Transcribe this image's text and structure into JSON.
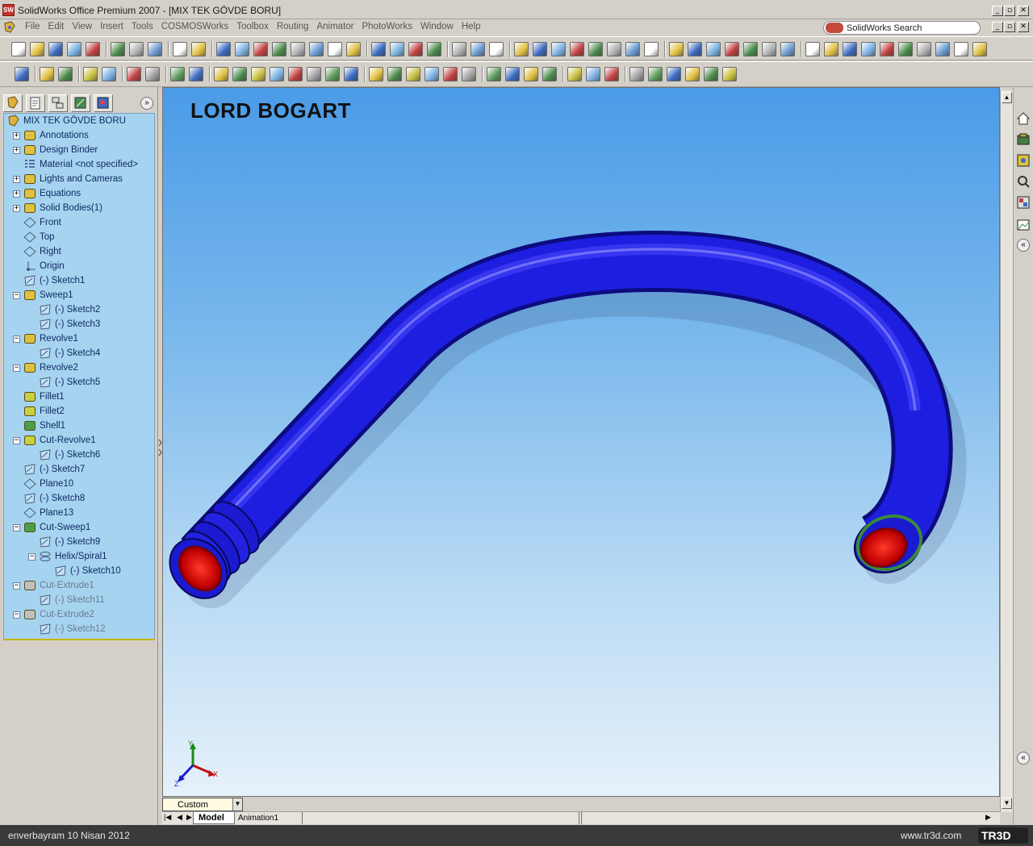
{
  "window": {
    "app_icon_text": "SW",
    "title": "SolidWorks Office Premium 2007 - [MIX TEK GÖVDE BORU]",
    "btn_min": "_",
    "btn_restore": "▫",
    "btn_close": "✕"
  },
  "menubar": {
    "items": [
      "File",
      "Edit",
      "View",
      "Insert",
      "Tools",
      "COSMOSWorks",
      "Toolbox",
      "Routing",
      "Animator",
      "PhotoWorks",
      "Window",
      "Help"
    ],
    "search_label": "SolidWorks Search"
  },
  "tree": {
    "root": "MIX TEK GÖVDE BORU",
    "items": [
      {
        "label": "Annotations",
        "expander": "+",
        "icon": "annotations-icon"
      },
      {
        "label": "Design Binder",
        "expander": "+",
        "icon": "design-binder-icon"
      },
      {
        "label": "Material <not specified>",
        "expander": "",
        "icon": "material-icon"
      },
      {
        "label": "Lights and Cameras",
        "expander": "+",
        "icon": "lights-icon"
      },
      {
        "label": "Equations",
        "expander": "+",
        "icon": "equations-icon"
      },
      {
        "label": "Solid Bodies(1)",
        "expander": "+",
        "icon": "solid-bodies-icon"
      },
      {
        "label": "Front",
        "expander": "",
        "icon": "plane-icon"
      },
      {
        "label": "Top",
        "expander": "",
        "icon": "plane-icon"
      },
      {
        "label": "Right",
        "expander": "",
        "icon": "plane-icon"
      },
      {
        "label": "Origin",
        "expander": "",
        "icon": "origin-icon"
      },
      {
        "label": "(-) Sketch1",
        "expander": "",
        "icon": "sketch-icon"
      },
      {
        "label": "Sweep1",
        "expander": "−",
        "icon": "sweep-icon"
      },
      {
        "label": "(-) Sketch2",
        "expander": "",
        "icon": "sketch-icon",
        "indent": 1
      },
      {
        "label": "(-) Sketch3",
        "expander": "",
        "icon": "sketch-icon",
        "indent": 1
      },
      {
        "label": "Revolve1",
        "expander": "−",
        "icon": "revolve-icon"
      },
      {
        "label": "(-) Sketch4",
        "expander": "",
        "icon": "sketch-icon",
        "indent": 1
      },
      {
        "label": "Revolve2",
        "expander": "−",
        "icon": "revolve-icon"
      },
      {
        "label": "(-) Sketch5",
        "expander": "",
        "icon": "sketch-icon",
        "indent": 1
      },
      {
        "label": "Fillet1",
        "expander": "",
        "icon": "fillet-icon"
      },
      {
        "label": "Fillet2",
        "expander": "",
        "icon": "fillet-icon"
      },
      {
        "label": "Shell1",
        "expander": "",
        "icon": "shell-icon"
      },
      {
        "label": "Cut-Revolve1",
        "expander": "−",
        "icon": "cut-revolve-icon"
      },
      {
        "label": "(-) Sketch6",
        "expander": "",
        "icon": "sketch-icon",
        "indent": 1
      },
      {
        "label": "(-) Sketch7",
        "expander": "",
        "icon": "sketch-icon"
      },
      {
        "label": "Plane10",
        "expander": "",
        "icon": "plane-icon"
      },
      {
        "label": "(-) Sketch8",
        "expander": "",
        "icon": "sketch-icon"
      },
      {
        "label": "Plane13",
        "expander": "",
        "icon": "plane-icon"
      },
      {
        "label": "Cut-Sweep1",
        "expander": "−",
        "icon": "cut-sweep-icon"
      },
      {
        "label": "(-) Sketch9",
        "expander": "",
        "icon": "sketch-icon",
        "indent": 1
      },
      {
        "label": "Helix/Spiral1",
        "expander": "−",
        "icon": "helix-icon",
        "indent": 1
      },
      {
        "label": "(-) Sketch10",
        "expander": "",
        "icon": "sketch-icon",
        "indent": 2
      },
      {
        "label": "Cut-Extrude1",
        "expander": "−",
        "icon": "cut-extrude-icon",
        "gray": true
      },
      {
        "label": "(-) Sketch11",
        "expander": "",
        "icon": "sketch-icon",
        "indent": 1,
        "gray": true
      },
      {
        "label": "Cut-Extrude2",
        "expander": "−",
        "icon": "cut-extrude-icon",
        "gray": true
      },
      {
        "label": "(-) Sketch12",
        "expander": "",
        "icon": "sketch-icon",
        "indent": 1,
        "gray": true
      }
    ]
  },
  "viewport": {
    "overlay_title": "LORD BOGART",
    "triad": {
      "x": "X",
      "y": "Y",
      "z": "Z"
    },
    "pipe_color": "#1a1acc",
    "opening_color": "#e01010",
    "thread_color": "#3a8a3a"
  },
  "bottom": {
    "view_select": "Custom",
    "tabs": [
      "Model",
      "Animation1"
    ],
    "active_tab": "Model"
  },
  "statusbar": {
    "left_text": "enverbayram 10 Nisan 2012",
    "right_text": "www.tr3d.com",
    "logo_text": "TR3D"
  },
  "colors": {
    "tree_bg": "#a6d4f0",
    "viewport_top": "#4a9be8",
    "viewport_bottom": "#e6f1fa"
  }
}
